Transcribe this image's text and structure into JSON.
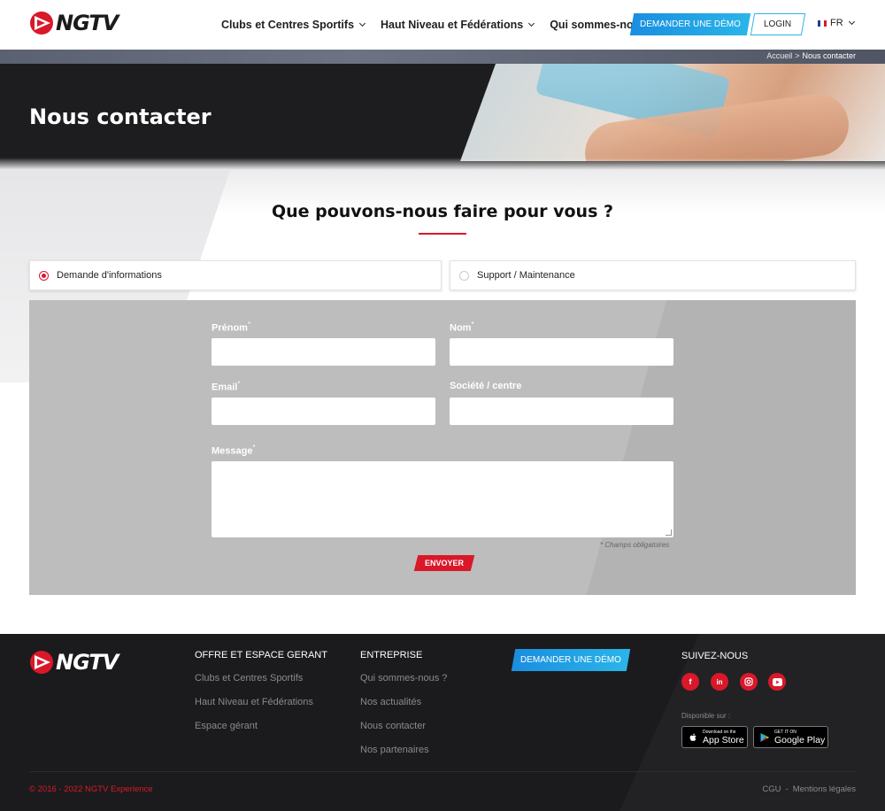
{
  "header": {
    "logo_text": "NGTV",
    "nav": [
      "Clubs et Centres Sportifs",
      "Haut Niveau et Fédérations",
      "Qui sommes-nous ?"
    ],
    "demo_label": "DEMANDER UNE DÉMO",
    "login_label": "LOGIN",
    "lang": "FR"
  },
  "breadcrumb": {
    "home": "Accueil",
    "separator": ">",
    "current": "Nous contacter"
  },
  "hero": {
    "title": "Nous contacter"
  },
  "main": {
    "heading": "Que pouvons-nous faire pour vous ?",
    "options": [
      {
        "label": "Demande d'informations",
        "selected": true
      },
      {
        "label": "Support / Maintenance",
        "selected": false
      }
    ]
  },
  "form": {
    "prenom_label": "Prénom",
    "nom_label": "Nom",
    "email_label": "Email",
    "societe_label": "Société / centre",
    "message_label": "Message",
    "asterisk": "*",
    "required_note": "* Champs obligatoires",
    "submit_label": "ENVOYER"
  },
  "footer": {
    "logo_text": "NGTV",
    "col1_title": "OFFRE ET ESPACE GERANT",
    "col1_links": [
      "Clubs et Centres Sportifs",
      "Haut Niveau et Fédérations",
      "Espace gérant"
    ],
    "col2_title": "ENTREPRISE",
    "col2_links": [
      "Qui sommes-nous ?",
      "Nos actualités",
      "Nous contacter",
      "Nos partenaires"
    ],
    "demo_label": "DEMANDER UNE DÉMO",
    "follow_title": "SUIVEZ-NOUS",
    "social": [
      "f",
      "in",
      "ig",
      "yt"
    ],
    "available_on": "Disponible sur :",
    "app_store": {
      "small": "Download on the",
      "big": "App Store"
    },
    "google_play": {
      "small": "GET IT ON",
      "big": "Google Play"
    },
    "copyright": "© 2016 - 2022 NGTV Experience",
    "legal": [
      "CGU",
      "Mentions légales"
    ],
    "legal_sep": "-"
  },
  "colors": {
    "accent_red": "#d9182a",
    "accent_blue": "#1a8ee0",
    "dark": "#1b1b1d"
  }
}
